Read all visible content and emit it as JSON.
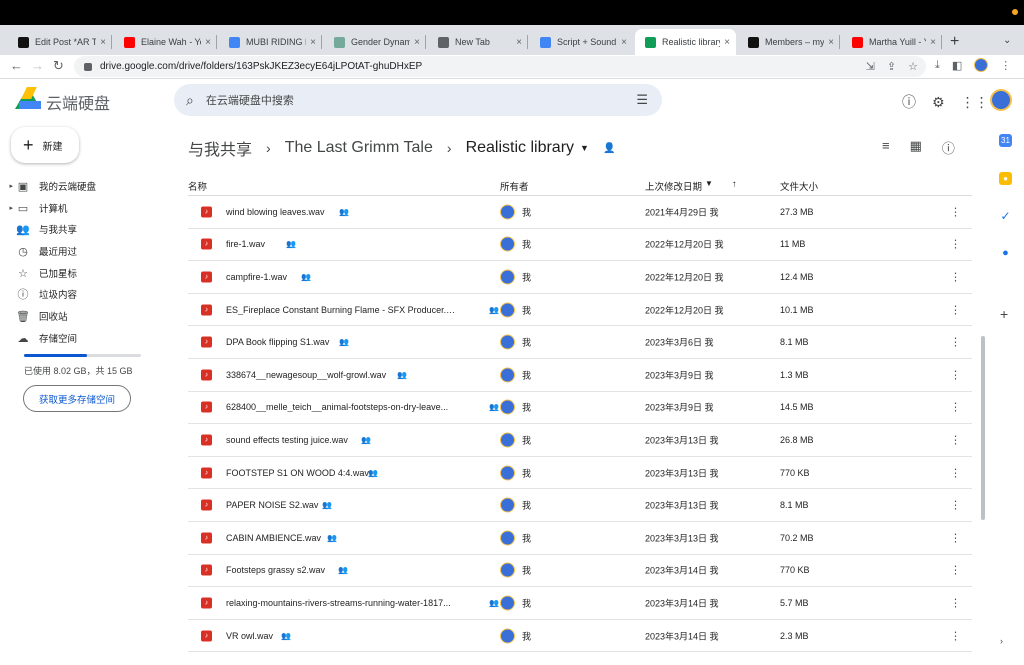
{
  "browser": {
    "tabs": [
      {
        "label": "Edit Post *AR TI",
        "icon": "imdb-icon",
        "color": "#111111"
      },
      {
        "label": "Elaine Wah - Yo",
        "icon": "youtube-icon",
        "color": "#ff0000"
      },
      {
        "label": "MUBI RIDING H",
        "icon": "google-icon",
        "color": "#4285f4"
      },
      {
        "label": "Gender Dynami",
        "icon": "openai-icon",
        "color": "#74aa9c"
      },
      {
        "label": "New Tab",
        "icon": "chrome-icon",
        "color": "#5f6368"
      },
      {
        "label": "Script + Sound",
        "icon": "docs-icon",
        "color": "#4285f4"
      },
      {
        "label": "Realistic library",
        "icon": "drive-icon",
        "color": "#0f9d58"
      },
      {
        "label": "Members – myl",
        "icon": "imdb-icon",
        "color": "#111111"
      },
      {
        "label": "Martha Yuill - Yo",
        "icon": "youtube-icon",
        "color": "#ff0000"
      }
    ],
    "new_tab": "+",
    "url": "drive.google.com/drive/folders/163PskJKEZ3ecyE64jLPOtAT-ghuDHxEP"
  },
  "header": {
    "brand": "云端硬盘",
    "search_placeholder": "在云端硬盘中搜索"
  },
  "sidebar": {
    "new_label": "新建",
    "items": [
      {
        "label": "我的云端硬盘",
        "icon": "my-drive-icon",
        "glyph": "▣",
        "caret": true
      },
      {
        "label": "计算机",
        "icon": "computer-icon",
        "glyph": "▭",
        "caret": true
      },
      {
        "label": "与我共享",
        "icon": "shared-icon",
        "glyph": "👥",
        "caret": false
      },
      {
        "label": "最近用过",
        "icon": "clock-icon",
        "glyph": "◷",
        "caret": false
      },
      {
        "label": "已加星标",
        "icon": "star-icon",
        "glyph": "☆",
        "caret": false
      },
      {
        "label": "垃圾内容",
        "icon": "spam-icon",
        "glyph": "ⓘ",
        "caret": false
      },
      {
        "label": "回收站",
        "icon": "trash-icon",
        "glyph": "🗑",
        "caret": false
      },
      {
        "label": "存储空间",
        "icon": "cloud-icon",
        "glyph": "☁",
        "caret": false
      }
    ],
    "storage_used_fraction": 0.535,
    "storage_text": "已使用 8.02 GB，共 15 GB",
    "buy_storage": "获取更多存储空间"
  },
  "breadcrumbs": {
    "items": [
      "与我共享",
      "The Last Grimm Tale",
      "Realistic library"
    ]
  },
  "columns": {
    "name": "名称",
    "owner": "所有者",
    "modified": "上次修改日期",
    "size": "文件大小"
  },
  "files": [
    {
      "name": "wind blowing leaves.wav",
      "owner": "我",
      "modified": "2021年4月29日 我",
      "size": "27.3 MB"
    },
    {
      "name": "fire-1.wav",
      "owner": "我",
      "modified": "2022年12月20日 我",
      "size": "11 MB"
    },
    {
      "name": "campfire-1.wav",
      "owner": "我",
      "modified": "2022年12月20日 我",
      "size": "12.4 MB"
    },
    {
      "name": "ES_Fireplace Constant Burning Flame - SFX Producer.w...",
      "owner": "我",
      "modified": "2022年12月20日 我",
      "size": "10.1 MB"
    },
    {
      "name": "DPA Book flipping S1.wav",
      "owner": "我",
      "modified": "2023年3月6日 我",
      "size": "8.1 MB"
    },
    {
      "name": "338674__newagesoup__wolf-growl.wav",
      "owner": "我",
      "modified": "2023年3月9日 我",
      "size": "1.3 MB"
    },
    {
      "name": "628400__melle_teich__animal-footsteps-on-dry-leave...",
      "owner": "我",
      "modified": "2023年3月9日 我",
      "size": "14.5 MB"
    },
    {
      "name": "sound effects testing juice.wav",
      "owner": "我",
      "modified": "2023年3月13日 我",
      "size": "26.8 MB"
    },
    {
      "name": "FOOTSTEP S1 ON WOOD 4:4.wav",
      "owner": "我",
      "modified": "2023年3月13日 我",
      "size": "770 KB"
    },
    {
      "name": "PAPER NOISE S2.wav",
      "owner": "我",
      "modified": "2023年3月13日 我",
      "size": "8.1 MB"
    },
    {
      "name": "CABIN AMBIENCE.wav",
      "owner": "我",
      "modified": "2023年3月13日 我",
      "size": "70.2 MB"
    },
    {
      "name": "Footsteps grassy s2.wav",
      "owner": "我",
      "modified": "2023年3月14日 我",
      "size": "770 KB"
    },
    {
      "name": "relaxing-mountains-rivers-streams-running-water-1817...",
      "owner": "我",
      "modified": "2023年3月14日 我",
      "size": "5.7 MB"
    },
    {
      "name": "VR owl.wav",
      "owner": "我",
      "modified": "2023年3月14日 我",
      "size": "2.3 MB"
    }
  ],
  "colors": {
    "accent": "#0b57d0",
    "audio_file": "#d93025"
  }
}
